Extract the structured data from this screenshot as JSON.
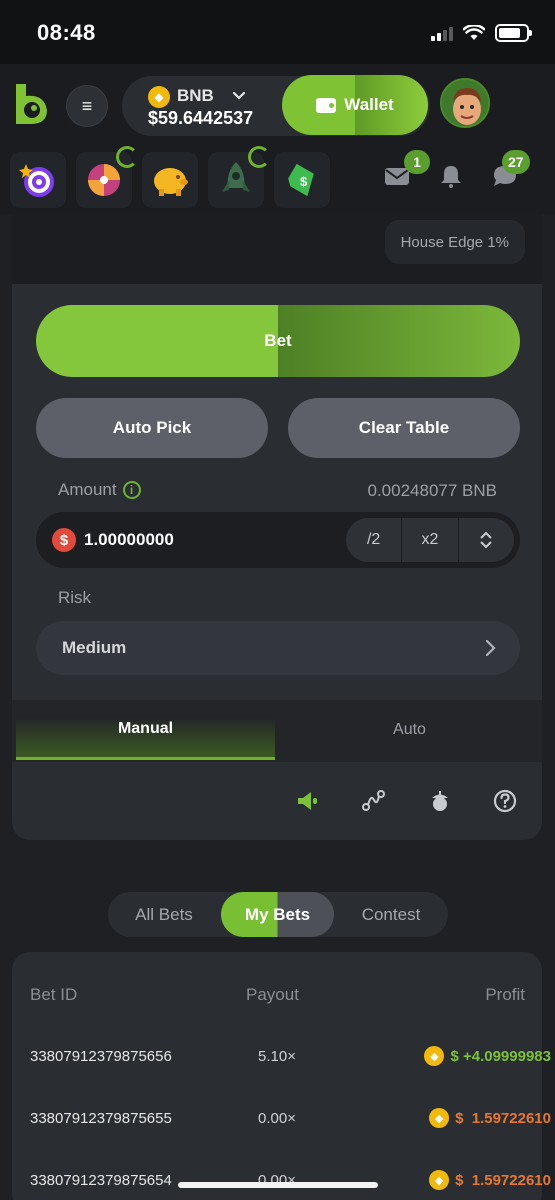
{
  "status_bar": {
    "time": "08:48"
  },
  "header": {
    "menu_glyph": "≡",
    "currency": "BNB",
    "balance": "$59.6442537",
    "wallet_label": "Wallet"
  },
  "icon_row": {
    "mail_count": "1",
    "chat_count": "27"
  },
  "game": {
    "house_edge": "House Edge 1%",
    "bet_label": "Bet",
    "auto_pick_label": "Auto Pick",
    "clear_table_label": "Clear Table",
    "amount_label": "Amount",
    "amount_conversion": "0.00248077 BNB",
    "amount_value": "1.00000000",
    "half_label": "/2",
    "double_label": "x2",
    "risk_label": "Risk",
    "risk_value": "Medium",
    "tabs": [
      {
        "label": "Manual"
      },
      {
        "label": "Auto"
      }
    ]
  },
  "bets": {
    "toggle": [
      {
        "label": "All Bets"
      },
      {
        "label": "My Bets"
      },
      {
        "label": "Contest"
      }
    ],
    "headers": {
      "id": "Bet ID",
      "payout": "Payout",
      "profit": "Profit"
    },
    "rows": [
      {
        "id": "33807912379875656",
        "payout": "5.10×",
        "profit": "$ +4.09999983",
        "result": "win"
      },
      {
        "id": "33807912379875655",
        "payout": "0.00×",
        "profit": "$  1.59722610",
        "result": "loss"
      },
      {
        "id": "33807912379875654",
        "payout": "0.00×",
        "profit": "$  1.59722610",
        "result": "loss"
      }
    ]
  },
  "colors": {
    "accent": "#7fc334",
    "loss": "#e8782f",
    "coin": "#f0b90b",
    "background": "#1e2024"
  }
}
